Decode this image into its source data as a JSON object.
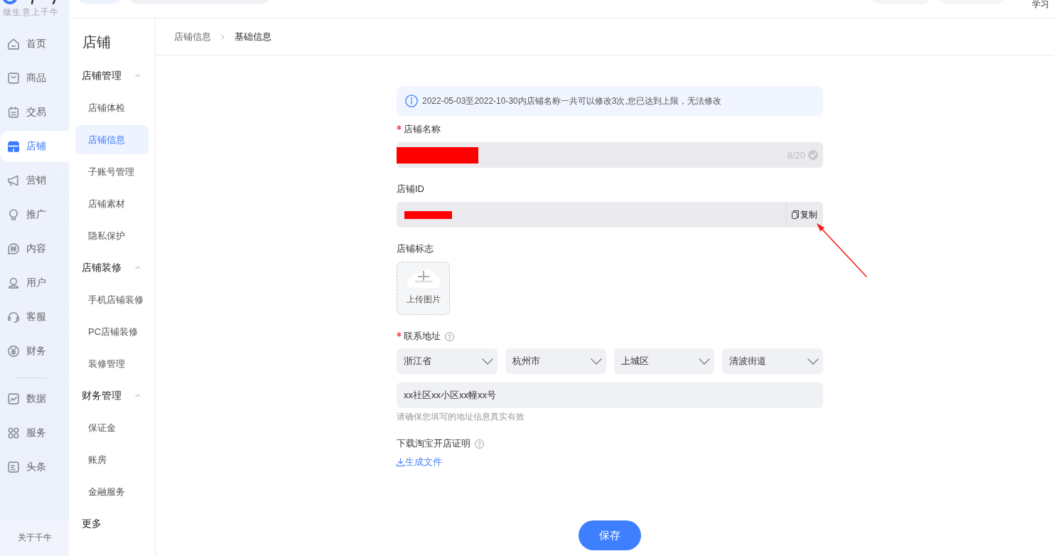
{
  "sidebar": {
    "tagline": "做生意上千牛",
    "sections": [
      {
        "items": [
          {
            "label": "首页",
            "selected": false
          },
          {
            "label": "商品",
            "selected": false
          },
          {
            "label": "交易",
            "selected": false
          },
          {
            "label": "店铺",
            "selected": true
          },
          {
            "label": "营销",
            "selected": false
          },
          {
            "label": "推广",
            "selected": false
          },
          {
            "label": "内容",
            "selected": false
          },
          {
            "label": "用户",
            "selected": false
          },
          {
            "label": "客服",
            "selected": false
          },
          {
            "label": "财务",
            "selected": false
          }
        ]
      },
      {
        "items": [
          {
            "label": "数据",
            "selected": false
          },
          {
            "label": "服务",
            "selected": false
          },
          {
            "label": "头条",
            "selected": false
          }
        ]
      }
    ],
    "footer_link": "关于千牛"
  },
  "top_bar": {
    "link": "学习"
  },
  "sub_nav": {
    "title": "店铺",
    "groups": [
      {
        "label": "店铺管理",
        "expanded": true,
        "items": [
          {
            "label": "店铺体检",
            "selected": false
          },
          {
            "label": "店铺信息",
            "selected": true
          },
          {
            "label": "子账号管理",
            "selected": false
          },
          {
            "label": "店铺素材",
            "selected": false
          },
          {
            "label": "隐私保护",
            "selected": false
          }
        ]
      },
      {
        "label": "店铺装修",
        "expanded": true,
        "items": [
          {
            "label": "手机店铺装修",
            "selected": false
          },
          {
            "label": "PC店铺装修",
            "selected": false
          },
          {
            "label": "装修管理",
            "selected": false
          }
        ]
      },
      {
        "label": "财务管理",
        "expanded": true,
        "items": [
          {
            "label": "保证金",
            "selected": false
          },
          {
            "label": "账房",
            "selected": false
          },
          {
            "label": "金融服务",
            "selected": false
          }
        ]
      }
    ],
    "more": "更多"
  },
  "breadcrumb": [
    "店铺信息",
    "基础信息"
  ],
  "form": {
    "notice": "2022-05-03至2022-10-30内店铺名称一共可以修改3次,您已达到上限，无法修改",
    "fields": [
      {
        "kind": "text",
        "label": "店铺名称",
        "required": true,
        "redacted": true,
        "counter": "8/20"
      },
      {
        "kind": "copy",
        "label": "店铺ID",
        "redacted": true,
        "action": "复制"
      },
      {
        "kind": "upload",
        "label": "店铺标志",
        "action": "上传图片"
      },
      {
        "kind": "address",
        "label": "联系地址",
        "required": true,
        "help": true,
        "regions": [
          "浙江省",
          "杭州市",
          "上城区",
          "清波街道"
        ],
        "value": "xx社区xx小区xx幢xx号",
        "hint": "请确保您填写的地址信息真实有效"
      },
      {
        "kind": "download",
        "label": "下载淘宝开店证明",
        "help": true,
        "link": "生成文件"
      }
    ]
  },
  "annotation": {
    "kind": "arrow"
  },
  "save_button": "保存"
}
